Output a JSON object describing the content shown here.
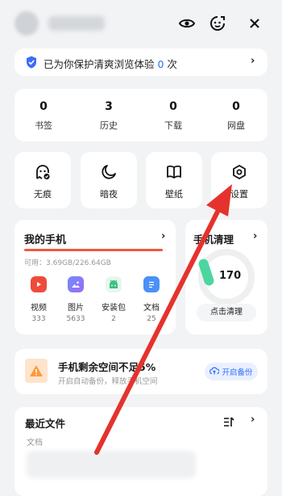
{
  "protect": {
    "prefix": "已为你保护清爽浏览体验 ",
    "count": "0",
    "suffix": " 次"
  },
  "stats": [
    {
      "num": "0",
      "label": "书签"
    },
    {
      "num": "3",
      "label": "历史"
    },
    {
      "num": "0",
      "label": "下载"
    },
    {
      "num": "0",
      "label": "网盘"
    }
  ],
  "tiles": [
    {
      "label": "无痕",
      "icon": "incognito-ghost-icon"
    },
    {
      "label": "暗夜",
      "icon": "moon-icon"
    },
    {
      "label": "壁纸",
      "icon": "book-open-icon"
    },
    {
      "label": "设置",
      "icon": "settings-hexagon-icon"
    }
  ],
  "my_phone": {
    "title": "我的手机",
    "available": "可用：3.69GB/226.64GB",
    "used_fraction": 0.98,
    "apps": [
      {
        "name": "视频",
        "count": "333",
        "icon": "video-play-icon",
        "color": "#ef4b3a"
      },
      {
        "name": "图片",
        "count": "5633",
        "icon": "image-icon",
        "color": "#5b7cf6"
      },
      {
        "name": "安装包",
        "count": "2",
        "icon": "android-icon",
        "color": "#3fbf7f"
      },
      {
        "name": "文档",
        "count": "25",
        "icon": "document-icon",
        "color": "#4a90f7"
      }
    ]
  },
  "clean": {
    "title": "手机清理",
    "value": "170",
    "button": "点击清理"
  },
  "storage": {
    "title": "手机剩余空间不足5%",
    "subtitle": "开启自动备份，释放手机空间",
    "backup_button": "开启备份"
  },
  "recent": {
    "title": "最近文件",
    "category": "文档"
  },
  "colors": {
    "accent": "#2f6bff",
    "warning": "#f05a3f",
    "annotation_arrow": "#e5322d"
  }
}
